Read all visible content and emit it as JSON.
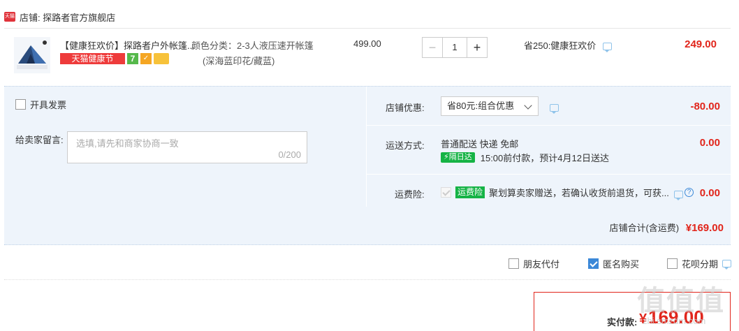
{
  "store": {
    "badge": "天猫",
    "name": "店铺: 探路者官方旗舰店"
  },
  "item": {
    "title": "【健康狂欢价】探路者户外帐篷...",
    "tags": {
      "health": "天猫健康节",
      "seven": "7"
    },
    "sku_label": "颜色分类：2-3人液压速开帐篷",
    "sku_value2": "(深海蓝印花/藏蓝)",
    "unit_price": "499.00",
    "qty_minus": "−",
    "qty_value": "1",
    "qty_plus": "+",
    "discount": "省250:健康狂欢价",
    "total": "249.00"
  },
  "invoice_label": "开具发票",
  "message": {
    "label": "给卖家留言:",
    "placeholder": "选填,请先和商家协商一致",
    "count": "0/200"
  },
  "shop_discount": {
    "label": "店铺优惠:",
    "selected": "省80元:组合优惠",
    "value": "-80.00"
  },
  "shipping": {
    "label": "运送方式:",
    "line1": "普通配送 快递 免邮",
    "badge": "⚡隔日达",
    "line2": "15:00前付款，预计4月12日送达",
    "value": "0.00"
  },
  "insurance": {
    "label": "运费险:",
    "badge": "运费险",
    "text": "聚划算卖家赠送，若确认收货前退货，可获...",
    "help": "?",
    "value": "0.00"
  },
  "store_total": {
    "label": "店铺合计(含运费)",
    "amount": "¥169.00"
  },
  "options": {
    "friend_pay": "朋友代付",
    "anonymous": "匿名购买",
    "huabei": "花呗分期"
  },
  "pay": {
    "label": "实付款:",
    "yen": "¥",
    "amount": "169.00"
  },
  "watermark": {
    "main": "值值值",
    "sub": "zhi.smzdm.com"
  },
  "colors": {
    "price_red": "#e1251b",
    "panel_bg": "#eef4fb",
    "accent_blue": "#3b88d8",
    "green": "#15b345"
  }
}
